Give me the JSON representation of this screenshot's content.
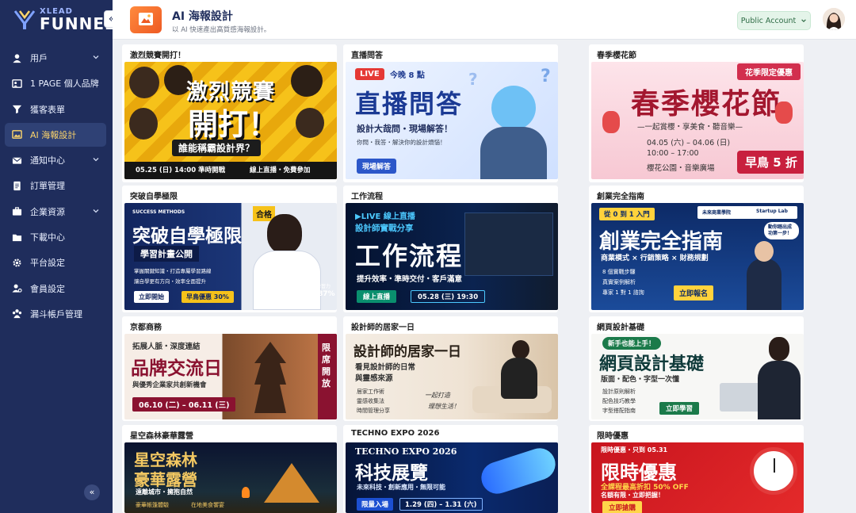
{
  "brand": {
    "top": "XLEAD",
    "main": "FUNNEL"
  },
  "sidebar": {
    "collapse_top": "«",
    "collapse_bottom": "«",
    "items": [
      {
        "label": "用戶",
        "icon": "user-icon",
        "chevron": true
      },
      {
        "label": "1 PAGE 個人品牌",
        "icon": "id-card-icon",
        "chevron": false
      },
      {
        "label": "獲客表單",
        "icon": "funnel-icon",
        "chevron": false
      },
      {
        "label": "AI 海報設計",
        "icon": "image-icon",
        "chevron": false,
        "active": true
      },
      {
        "label": "通知中心",
        "icon": "mail-icon",
        "chevron": true
      },
      {
        "label": "訂單管理",
        "icon": "document-icon",
        "chevron": false
      },
      {
        "label": "企業資源",
        "icon": "briefcase-icon",
        "chevron": true
      },
      {
        "label": "下載中心",
        "icon": "folder-icon",
        "chevron": false
      },
      {
        "label": "平台設定",
        "icon": "gear-icon",
        "chevron": false
      },
      {
        "label": "會員設定",
        "icon": "member-gear-icon",
        "chevron": false
      },
      {
        "label": "漏斗帳戶管理",
        "icon": "users-icon",
        "chevron": false
      }
    ]
  },
  "header": {
    "title": "AI 海報設計",
    "subtitle": "以 AI 快速產出高質感海報設計。",
    "account_label": "Public Account"
  },
  "colors": {
    "sidebar": "#1f2d5c",
    "accent": "#ffd66b",
    "account_bg": "#e4f4e9"
  },
  "posters": [
    {
      "title": "激烈競賽開打！",
      "lines": [
        "激烈競賽",
        "開打！",
        "誰能稱霸設計界？",
        "05.25 (日) 14:00 準時開戰",
        "線上直播・免費參加"
      ]
    },
    {
      "title": "直播問答",
      "lines": [
        "LIVE",
        "今晚 8 點",
        "直播問答",
        "設計大哉問・現場解答！",
        "你問・我答・解決你的設計煩惱！",
        "現場解答"
      ]
    },
    {
      "title": "春季櫻花節",
      "lines": [
        "花季限定優惠",
        "春季櫻花節",
        "—一起賞櫻・享美食・聽音樂—",
        "04.05 (六) – 04.06 (日)",
        "10:00 – 17:00",
        "櫻花公園・音樂廣場",
        "早鳥 5 折"
      ]
    },
    {
      "title": "突破自學極限",
      "lines": [
        "SUCCESS METHODS",
        "合格",
        "突破自學極限",
        "學習計畫公開",
        "掌握關鍵知識・打造專屬學習路線",
        "讓自學更有方向・效率全面提升",
        "立即開始",
        "早鳥優惠 30%",
        "學習力",
        "87%"
      ]
    },
    {
      "title": "工作流程",
      "lines": [
        "▶LIVE 線上直播",
        "設計師實戰分享",
        "工作流程",
        "提升效率・準時交付・客戶滿意",
        "線上直播",
        "05.28 (三) 19:30"
      ]
    },
    {
      "title": "創業完全指南",
      "lines": [
        "從 0 到 1 入門",
        "未來商業學院",
        "Startup Lab",
        "動你踏出成功第一步！",
        "創業完全指南",
        "商業模式 × 行銷策略 × 財務規劃",
        "8 個實戰步驟",
        "真實案例解析",
        "專家 1 對 1 諮詢",
        "立即報名"
      ]
    },
    {
      "title": "京都商務",
      "lines": [
        "拓展人脈・深度連結",
        "品牌交流日",
        "與優秀企業家共創新機會",
        "06.10 (二) – 06.11 (三)",
        "限席開放"
      ]
    },
    {
      "title": "設計師的居家一日",
      "lines": [
        "設計師的居家一日",
        "看見設計師的日常",
        "與靈感來源",
        "居家工作術",
        "靈感收集法",
        "時間管理分享",
        "一起打造",
        "理想生活！"
      ]
    },
    {
      "title": "網頁設計基礎",
      "lines": [
        "新手也能上手！",
        "網頁設計基礎",
        "版面・配色・字型一次懂",
        "設計原則解析",
        "配色技巧教學",
        "字型搭配指南",
        "立即學習"
      ]
    },
    {
      "title": "星空森林豪華露營",
      "lines": [
        "星空森林",
        "豪華露營",
        "遠離城市・擁抱自然",
        "豪華帳篷體驗",
        "在地美食饗宴"
      ]
    },
    {
      "title": "TECHNO EXPO 2026",
      "lines": [
        "TECHNO EXPO 2026",
        "科技展覽",
        "未來科技・創新應用・無限可能",
        "限量入場",
        "1.29 (四) – 1.31 (六)"
      ]
    },
    {
      "title": "限時優惠",
      "lines": [
        "限時優惠・只到 05.31",
        "限時優惠",
        "全課程最高折扣 50% OFF",
        "名額有限・立即把握！",
        "立即搶購"
      ]
    }
  ]
}
